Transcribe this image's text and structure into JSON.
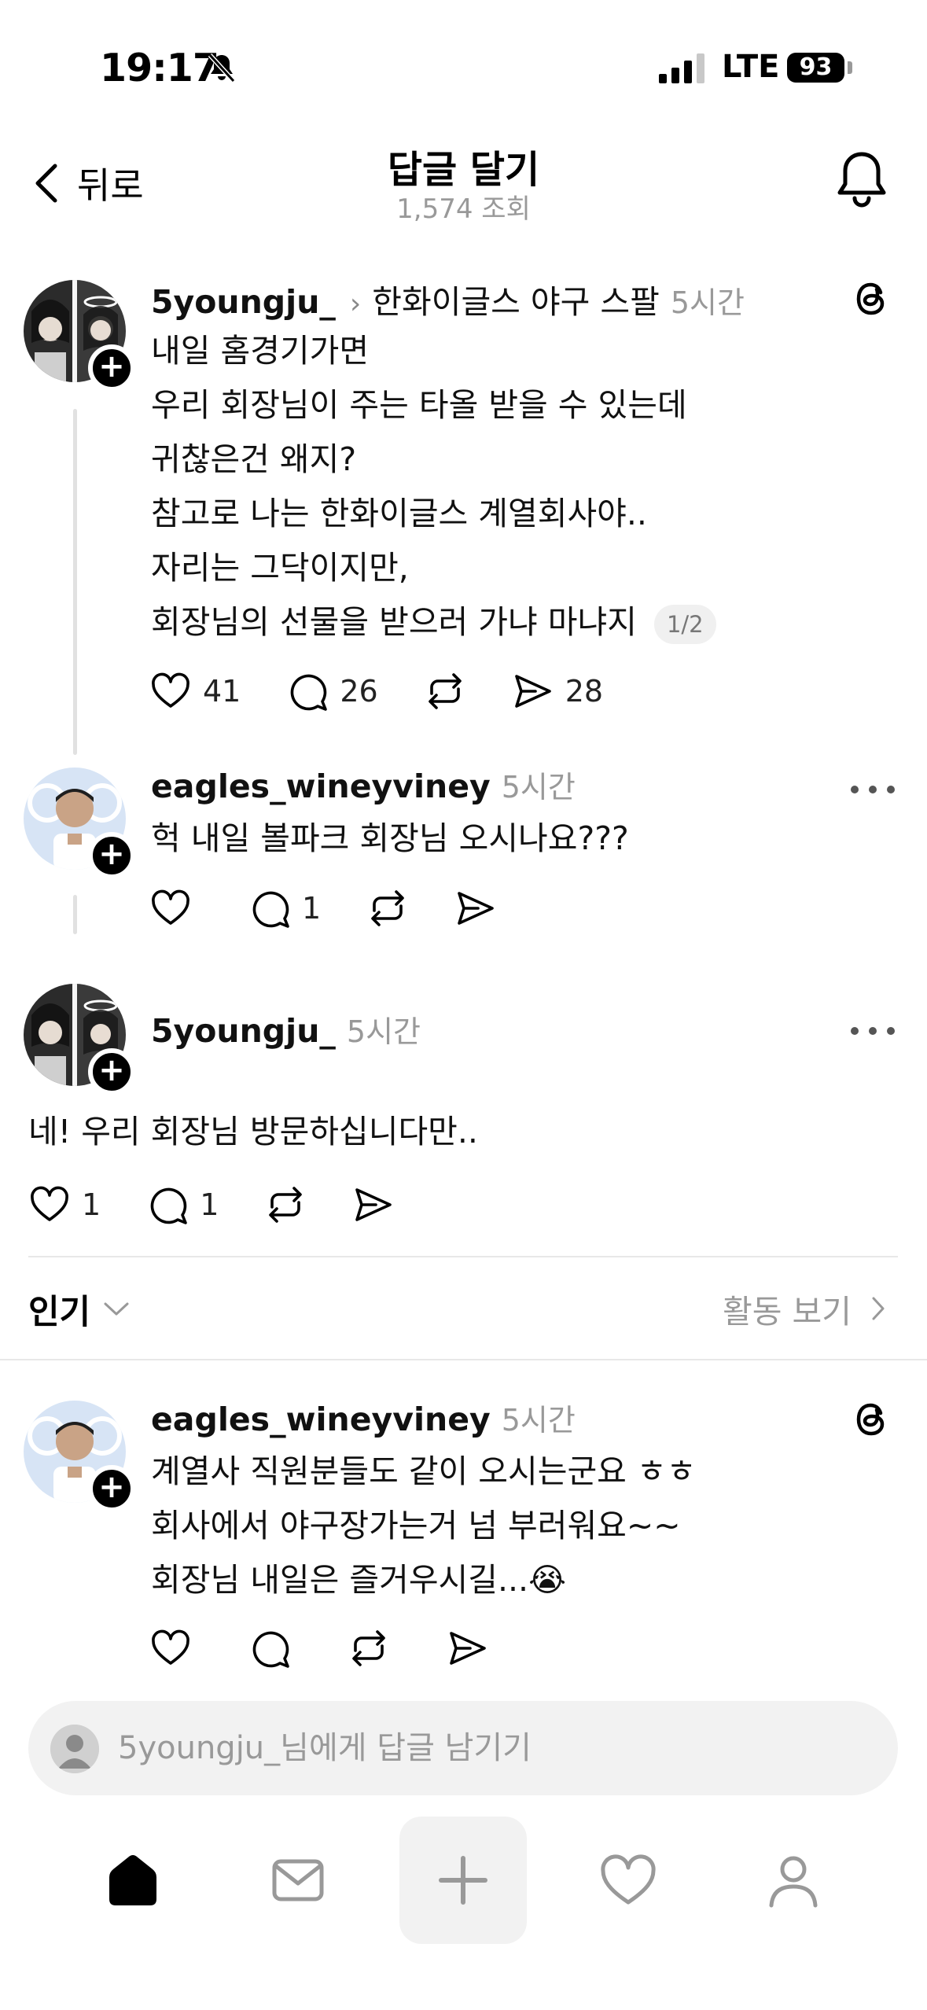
{
  "status_bar": {
    "time": "19:17",
    "network": "LTE",
    "battery": "93"
  },
  "header": {
    "back_label": "뒤로",
    "title": "답글 달기",
    "views": "1,574 조회"
  },
  "posts": [
    {
      "username": "5youngju_",
      "topic": "한화이글스 야구 스팔",
      "time": "5시간",
      "lines": [
        "내일 홈경기가면",
        "우리 회장님이 주는 타올 받을 수 있는데",
        "귀찮은건 왜지?",
        "참고로 나는 한화이글스 계열회사야..",
        "자리는 그닥이지만,",
        "회장님의 선물을 받으러 가냐 마냐지"
      ],
      "page_indicator": "1/2",
      "likes": "41",
      "comments": "26",
      "shares": "28"
    },
    {
      "username": "eagles_wineyviney",
      "time": "5시간",
      "lines": [
        "헉 내일 볼파크 회장님 오시나요???"
      ],
      "likes": "",
      "comments": "1"
    },
    {
      "username": "5youngju_",
      "time": "5시간",
      "lines": [
        "네! 우리 회장님 방문하십니다만.."
      ],
      "likes": "1",
      "comments": "1"
    },
    {
      "username": "eagles_wineyviney",
      "time": "5시간",
      "lines": [
        "계열사 직원분들도 같이 오시는군요 ㅎㅎ",
        "회사에서 야구장가는거 넘 부러워요~~",
        "회장님 내일은 즐거우시길...😭"
      ]
    }
  ],
  "sort": {
    "label": "인기",
    "activity_label": "활동 보기"
  },
  "reply": {
    "placeholder": "5youngju_님에게 답글 남기기"
  },
  "icons": {
    "status": [
      "bell-slash-icon",
      "signal-icon"
    ],
    "header": [
      "chevron-left-icon",
      "bell-icon"
    ],
    "post_actions": [
      "heart-icon",
      "comment-icon",
      "repost-icon",
      "share-icon"
    ],
    "nav": [
      "home-icon",
      "inbox-icon",
      "plus-icon",
      "heart-icon",
      "profile-icon"
    ]
  }
}
